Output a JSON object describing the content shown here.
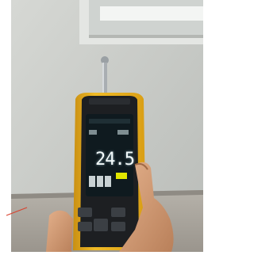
{
  "photo": {
    "subject": "handheld-moisture-meter",
    "colors": {
      "wall": "#c9ccc8",
      "window_frame": "#e7e9e6",
      "meter_body": "#e9b21c",
      "meter_bezel": "#1d1f22",
      "screen": "#0f1a1f",
      "readout": "#f4fbfb",
      "skin": "#d7a27c"
    }
  },
  "meter": {
    "display": {
      "reading": "24.5"
    }
  }
}
